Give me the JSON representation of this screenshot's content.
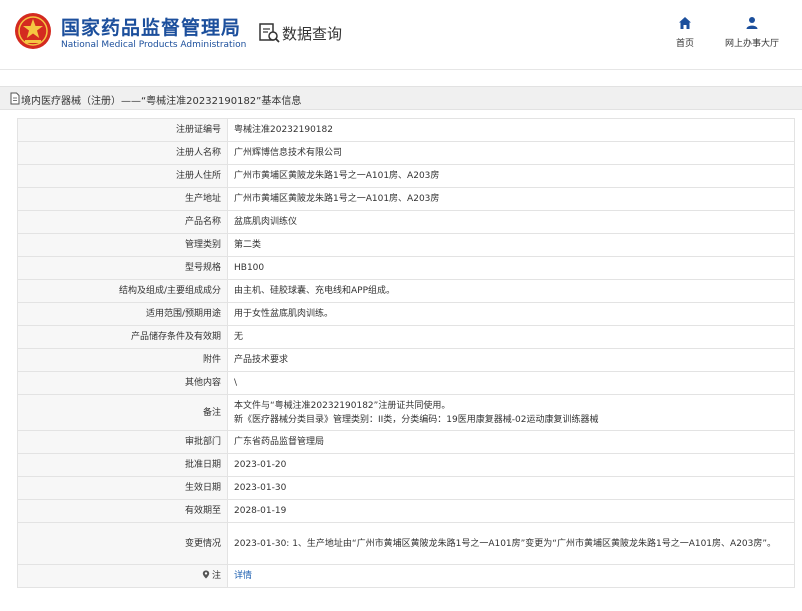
{
  "header": {
    "logo_cn": "国家药品监督管理局",
    "logo_en": "National Medical Products Administration",
    "query_label": "数据查询",
    "nav": [
      {
        "label": "首页",
        "icon": "home-icon"
      },
      {
        "label": "网上办事大厅",
        "icon": "person-icon"
      }
    ]
  },
  "titlebar": {
    "text": "境内医疗器械（注册）——“粤械注准20232190182”基本信息"
  },
  "rows": [
    {
      "label": "注册证编号",
      "value": "粤械注准20232190182"
    },
    {
      "label": "注册人名称",
      "value": "广州辉博信息技术有限公司"
    },
    {
      "label": "注册人住所",
      "value": "广州市黄埔区黄陂龙朱路1号之一A101房、A203房"
    },
    {
      "label": "生产地址",
      "value": "广州市黄埔区黄陂龙朱路1号之一A101房、A203房"
    },
    {
      "label": "产品名称",
      "value": "盆底肌肉训练仪"
    },
    {
      "label": "管理类别",
      "value": "第二类"
    },
    {
      "label": "型号规格",
      "value": "HB100"
    },
    {
      "label": "结构及组成/主要组成成分",
      "value": "由主机、硅胶球囊、充电线和APP组成。"
    },
    {
      "label": "适用范围/预期用途",
      "value": "用于女性盆底肌肉训练。"
    },
    {
      "label": "产品储存条件及有效期",
      "value": "无"
    },
    {
      "label": "附件",
      "value": "产品技术要求"
    },
    {
      "label": "其他内容",
      "value": "\\"
    },
    {
      "label": "备注",
      "value_line1": "本文件与“粤械注准20232190182”注册证共同使用。",
      "value_line2": "新《医疗器械分类目录》管理类别：II类，分类编码：19医用康复器械-02运动康复训练器械"
    },
    {
      "label": "审批部门",
      "value": "广东省药品监督管理局"
    },
    {
      "label": "批准日期",
      "value": "2023-01-20"
    },
    {
      "label": "生效日期",
      "value": "2023-01-30"
    },
    {
      "label": "有效期至",
      "value": "2028-01-19"
    },
    {
      "label": "变更情况",
      "value": "2023-01-30: 1、生产地址由“广州市黄埔区黄陂龙朱路1号之一A101房”变更为“广州市黄埔区黄陂龙朱路1号之一A101房、A203房”。"
    },
    {
      "label": "注",
      "value": "详情"
    }
  ],
  "colors": {
    "brand_blue": "#1c4f9c",
    "link_blue": "#1c5fb0",
    "label_bg": "#f7f7f7",
    "titlebar_bg": "#f0f0f0"
  }
}
